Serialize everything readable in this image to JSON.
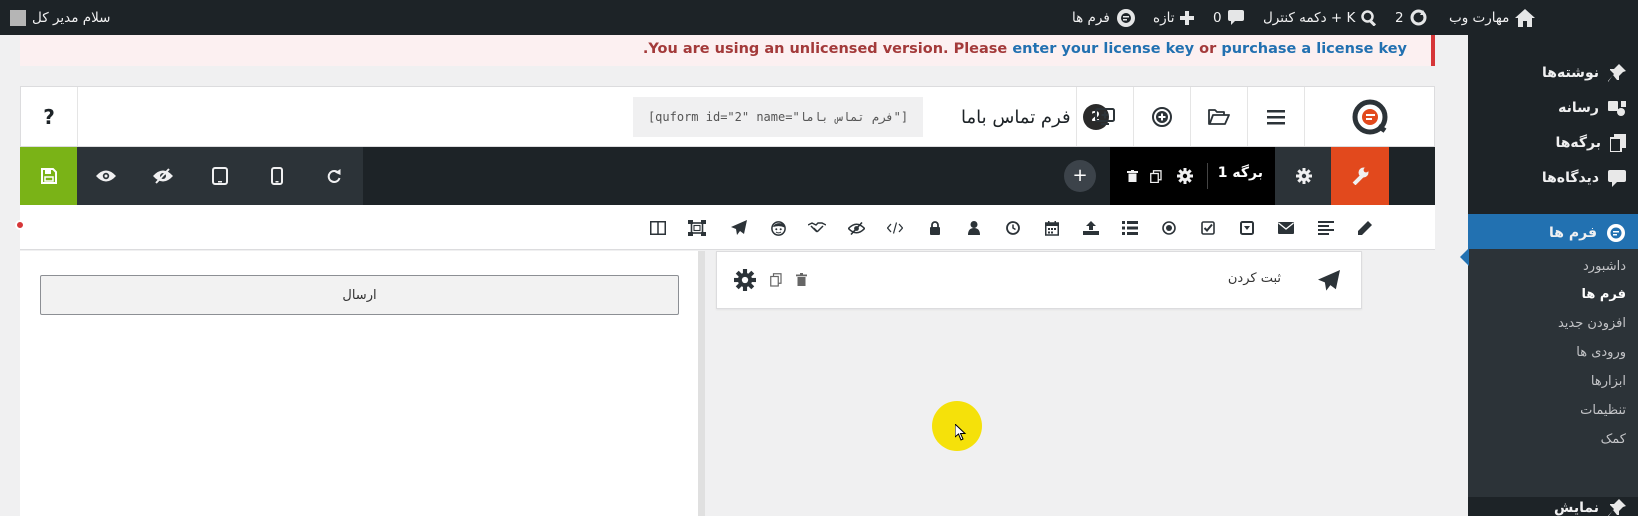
{
  "admin_bar": {
    "greeting": "سلام مدیر کل",
    "site_name": "مهارت وب",
    "updates_count": "2",
    "search_shortcut": "دکمه کنترل + K",
    "comments_count": "0",
    "new_label": "تازه",
    "forms_label": "فرم ها"
  },
  "admin_menu": {
    "items": [
      {
        "label": "نوشته‌ها",
        "icon": "pin-icon"
      },
      {
        "label": "رسانه",
        "icon": "media-icon"
      },
      {
        "label": "برگه‌ها",
        "icon": "pages-icon"
      },
      {
        "label": "دیدگاه‌ها",
        "icon": "comments-icon"
      },
      {
        "label": "فرم ها",
        "icon": "quform-icon"
      },
      {
        "label": "نمایش",
        "icon": "appearance-icon"
      }
    ],
    "submenu": [
      "داشبورد",
      "فرم ها",
      "افزودن جدید",
      "ورودی ها",
      "ابزارها",
      "تنظیمات",
      "کمک"
    ]
  },
  "notice": {
    "prefix": ".You are using an unlicensed version. Please ",
    "link1": "enter your license key",
    "middle": " or ",
    "link2": "purchase a license key"
  },
  "builder": {
    "help_label": "?",
    "form_id": "2",
    "form_title": "فرم تماس باما",
    "shortcode": "[quform id=\"2\" name=\"فرم تماس باما\"]",
    "page_tab_label": "برگه 1",
    "add_page_label": "+",
    "submit_button_label": "ارسال",
    "element_label": "ثبت کردن"
  },
  "colors": {
    "admin_dark": "#1d2327",
    "accent_blue": "#2271b1",
    "save_green": "#7ab317",
    "wrench_orange": "#e2491d",
    "notice_red": "#d63638"
  }
}
